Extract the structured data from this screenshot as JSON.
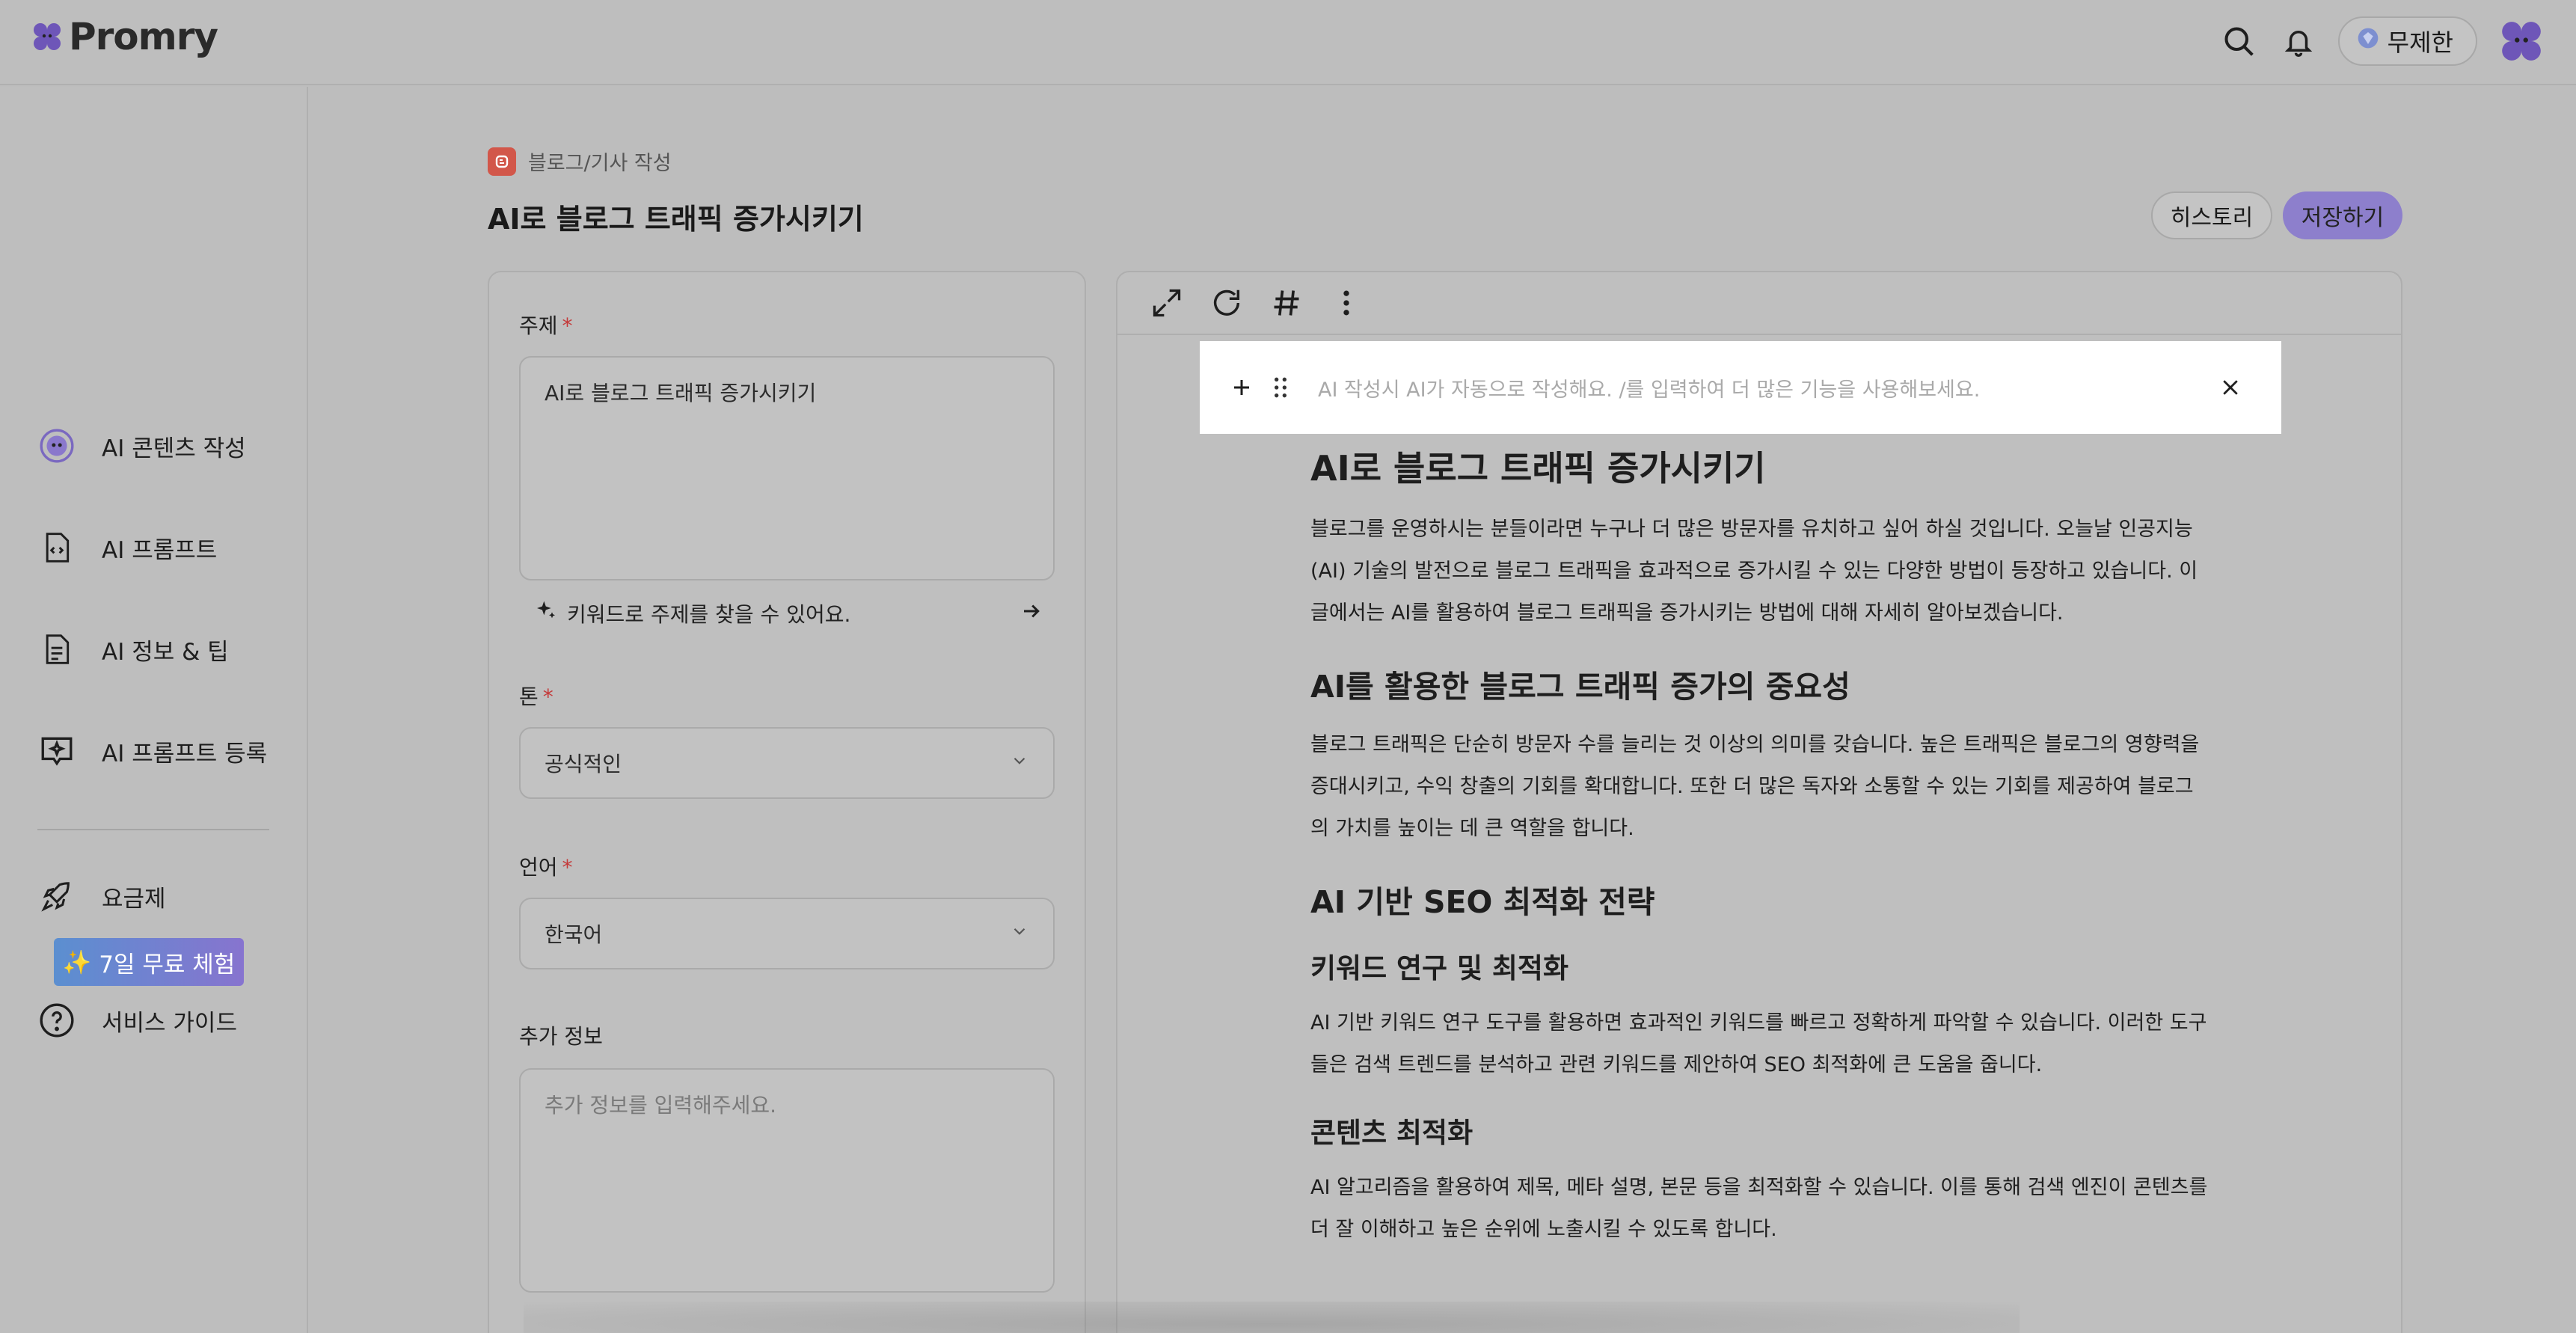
{
  "header": {
    "logo_text": "Promry",
    "plan_label": "무제한"
  },
  "sidebar": {
    "items": [
      {
        "label": "AI 콘텐츠 작성"
      },
      {
        "label": "AI 프롬프트"
      },
      {
        "label": "AI 정보 & 팁"
      },
      {
        "label": "AI 프롬프트 등록"
      }
    ],
    "pricing_label": "요금제",
    "trial_label": "7일 무료 체험",
    "guide_label": "서비스 가이드"
  },
  "page": {
    "breadcrumb_category": "블로그",
    "breadcrumb_separator": "/",
    "breadcrumb_page": "기사 작성",
    "title": "AI로 블로그 트래픽 증가시키기",
    "history_label": "히스토리",
    "save_label": "저장하기"
  },
  "form": {
    "topic_label": "주제",
    "required_mark": "*",
    "topic_value": "AI로 블로그 트래픽 증가시키기",
    "keyword_hint": "키워드로 주제를 찾을 수 있어요.",
    "tone_label": "톤",
    "tone_value": "공식적인",
    "language_label": "언어",
    "language_value": "한국어",
    "extra_label": "추가 정보",
    "extra_placeholder": "추가 정보를 입력해주세요."
  },
  "editor": {
    "prompt_placeholder": "AI 작성시 AI가 자동으로 작성해요. /를 입력하여 더 많은 기능을 사용해보세요.",
    "doc_title": "AI로 블로그 트래픽 증가시키기",
    "intro": "블로그를 운영하시는 분들이라면 누구나 더 많은 방문자를 유치하고 싶어 하실 것입니다. 오늘날 인공지능(AI) 기술의 발전으로 블로그 트래픽을 효과적으로 증가시킬 수 있는 다양한 방법이 등장하고 있습니다. 이 글에서는 AI를 활용하여 블로그 트래픽을 증가시키는 방법에 대해 자세히 알아보겠습니다.",
    "h2_importance": "AI를 활용한 블로그 트래픽 증가의 중요성",
    "p_importance": "블로그 트래픽은 단순히 방문자 수를 늘리는 것 이상의 의미를 갖습니다. 높은 트래픽은 블로그의 영향력을 증대시키고, 수익 창출의 기회를 확대합니다. 또한 더 많은 독자와 소통할 수 있는 기회를 제공하여 블로그의 가치를 높이는 데 큰 역할을 합니다.",
    "h2_seo": "AI 기반 SEO 최적화 전략",
    "h3_keyword": "키워드 연구 및 최적화",
    "p_keyword": "AI 기반 키워드 연구 도구를 활용하면 효과적인 키워드를 빠르고 정확하게 파악할 수 있습니다. 이러한 도구들은 검색 트렌드를 분석하고 관련 키워드를 제안하여 SEO 최적화에 큰 도움을 줍니다.",
    "h3_content": "콘텐츠 최적화",
    "p_content": "AI 알고리즘을 활용하여 제목, 메타 설명, 본문 등을 최적화할 수 있습니다. 이를 통해 검색 엔진이 콘텐츠를 더 잘 이해하고 높은 순위에 노출시킬 수 있도록 합니다."
  }
}
